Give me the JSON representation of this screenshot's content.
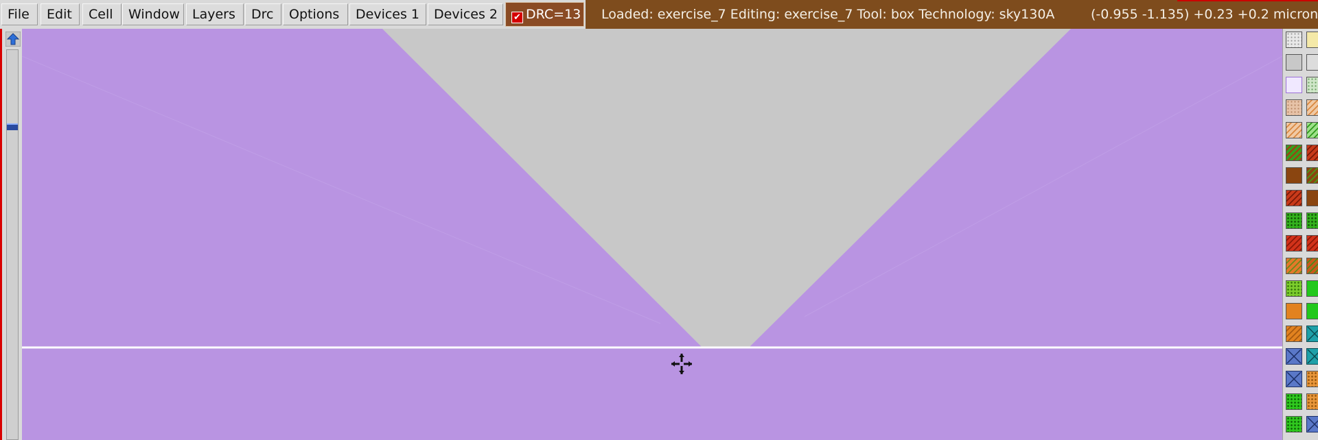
{
  "menu": {
    "items": [
      "File",
      "Edit",
      "Cell",
      "Window",
      "Layers",
      "Drc",
      "Options",
      "Devices 1",
      "Devices 2"
    ]
  },
  "drc": {
    "label": "DRC=13",
    "checked": true,
    "color": "#d40000"
  },
  "status": {
    "text": "Loaded: exercise_7 Editing: exercise_7 Tool: box  Technology: sky130A",
    "coords": "(-0.955 -1.135) +0.23 +0.2 microns"
  },
  "colors": {
    "canvas_background": "#c8c8c8",
    "layer_fill": "#b994e2",
    "status_bar": "#7e4c1d",
    "drc_button": "#8a4b24",
    "menu_bar": "#d9d9d9",
    "edge_highlight": "#ffffff"
  },
  "icons": [
    "up-arrow-icon",
    "crosshair-cursor-icon"
  ],
  "palette": {
    "columns": [
      [
        "dots-grid",
        "grey-solid",
        "purple-outline",
        "beige-dots",
        "orange-hatch",
        "green-red-hatch",
        "brown-solid",
        "red-hatch",
        "green-dots",
        "red-hatch",
        "orange-green-hatch",
        "green-dots-light",
        "orange-solid",
        "orange-hatch",
        "blue-cross",
        "blue-cross",
        "green-dots"
      ],
      [
        "yellow-outline",
        "light-solid",
        "green-dots-light",
        "orange-hatch",
        "green-hatch",
        "red-hatch",
        "brown-hatch",
        "brown-solid",
        "green-dots",
        "red-hatch",
        "green-hatch",
        "green-solid",
        "green-solid",
        "teal-cross",
        "teal-cross",
        "orange-dots",
        "orange-dots",
        "blue-cross"
      ]
    ]
  }
}
